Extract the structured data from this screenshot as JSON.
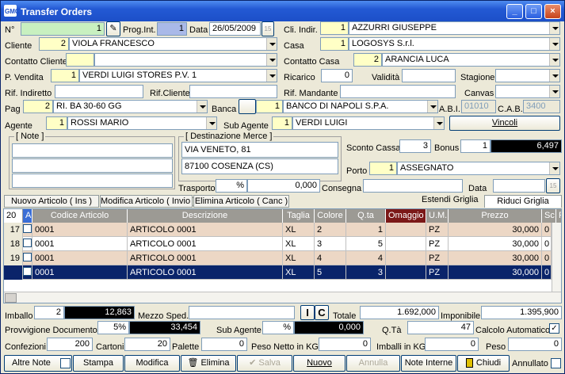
{
  "window": {
    "title": "Transfer Orders",
    "app_icon": "GMC"
  },
  "header": {
    "n_label": "N°",
    "n_value": "1",
    "prog_label": "Prog.Int.",
    "prog_value": "1",
    "data_label": "Data",
    "data_value": "26/05/2009",
    "cal_label": "15",
    "cli_indir_label": "Cli. Indir.",
    "cli_indir_code": "1",
    "cli_indir_name": "AZZURRI GIUSEPPE",
    "cliente_label": "Cliente",
    "cliente_code": "2",
    "cliente_name": "VIOLA FRANCESCO",
    "casa_label": "Casa",
    "casa_code": "1",
    "casa_name": "LOGOSYS S.r.l.",
    "contatto_cliente_label": "Contatto Cliente",
    "contatto_casa_label": "Contatto Casa",
    "contatto_casa_code": "2",
    "contatto_casa_name": "ARANCIA LUCA",
    "pvendita_label": "P. Vendita",
    "pvendita_code": "1",
    "pvendita_name": "VERDI LUIGI STORES P.V. 1",
    "ricarico_label": "Ricarico",
    "ricarico_value": "0",
    "validita_label": "Validità",
    "stagione_label": "Stagione",
    "rif_indiretto_label": "Rif. Indiretto",
    "rif_cliente_label": "Rif.Cliente",
    "rif_mandante_label": "Rif. Mandante",
    "canvas_label": "Canvas",
    "pag_label": "Pag",
    "pag_code": "2",
    "pag_name": "RI. BA 30-60 GG",
    "banca_label": "Banca",
    "banca_code": "1",
    "banca_name": "BANCO DI NAPOLI S.P.A.",
    "abi_label": "A.B.I.",
    "abi_value": "01010",
    "cab_label": "C.A.B.",
    "cab_value": "3400",
    "agente_label": "Agente",
    "agente_code": "1",
    "agente_name": "ROSSI MARIO",
    "sub_agente_label": "Sub Agente",
    "sub_agente_code": "1",
    "sub_agente_name": "VERDI LUIGI",
    "vincoli_label": "Vincoli"
  },
  "note": {
    "title": "[ Note ]"
  },
  "dest": {
    "title": "[ Destinazione Merce ]",
    "line1": "VIA VENETO, 81",
    "line2": "87100 COSENZA (CS)"
  },
  "mid": {
    "sconto_cassa_label": "Sconto Cassa",
    "sconto_cassa_value": "3",
    "bonus_label": "Bonus",
    "bonus_code": "1",
    "bonus_value": "6,497",
    "porto_label": "Porto",
    "porto_code": "1",
    "porto_name": "ASSEGNATO",
    "trasporto_label": "Trasporto",
    "trasporto_pct": "%",
    "trasporto_value": "0,000",
    "consegna_label": "Consegna",
    "data2_label": "Data",
    "cal2_label": "15"
  },
  "tabs": {
    "nuovo_articolo": "Nuovo Articolo ( Ins )",
    "modifica_articolo": "Modifica Articolo ( Invio )",
    "elimina_articolo": "Elimina Articolo ( Canc )",
    "estendi_griglia": "Estendi Griglia",
    "riduci_griglia": "Riduci Griglia"
  },
  "grid": {
    "count": "20",
    "headers": [
      "A",
      "Codice Articolo",
      "Descrizione",
      "Taglia",
      "Colore",
      "Q.ta",
      "Omaggio",
      "U.M.",
      "Prezzo",
      "Sc %",
      "F"
    ],
    "rows": [
      {
        "n": "17",
        "code": "0001",
        "desc": "ARTICOLO 0001",
        "taglia": "XL",
        "colore": "2",
        "qta": "1",
        "um": "PZ",
        "prezzo": "30,000",
        "sc": "0"
      },
      {
        "n": "18",
        "code": "0001",
        "desc": "ARTICOLO 0001",
        "taglia": "XL",
        "colore": "3",
        "qta": "5",
        "um": "PZ",
        "prezzo": "30,000",
        "sc": "0"
      },
      {
        "n": "19",
        "code": "0001",
        "desc": "ARTICOLO 0001",
        "taglia": "XL",
        "colore": "4",
        "qta": "4",
        "um": "PZ",
        "prezzo": "30,000",
        "sc": "0"
      },
      {
        "n": "",
        "code": "0001",
        "desc": "ARTICOLO 0001",
        "taglia": "XL",
        "colore": "5",
        "qta": "3",
        "um": "PZ",
        "prezzo": "30,000",
        "sc": "0"
      }
    ]
  },
  "footer": {
    "imballo_label": "Imballo",
    "imballo_code": "2",
    "imballo_value": "12,863",
    "mezzo_sped_label": "Mezzo Sped.",
    "i_label": "I",
    "c_label": "C",
    "totale_label": "Totale",
    "totale_value": "1.692,000",
    "imponibile_label": "Imponibile",
    "imponibile_value": "1.395,900",
    "provvigione_label": "Provvigione Documento",
    "provvigione_pct": "5%",
    "provvigione_value": "33,454",
    "sub_agente_label": "Sub Agente",
    "sub_agente_pct": "%",
    "sub_agente_value": "0,000",
    "qta_label": "Q.Tà",
    "qta_value": "47",
    "calcolo_label": "Calcolo Automatico",
    "confezioni_label": "Confezioni",
    "confezioni_value": "200",
    "cartoni_label": "Cartoni",
    "cartoni_value": "20",
    "palette_label": "Palette",
    "palette_value": "0",
    "peso_netto_label": "Peso Netto in KG",
    "peso_netto_value": "0",
    "imballi_label": "Imballi in KG",
    "imballi_value": "0",
    "peso_label": "Peso",
    "peso_value": "0"
  },
  "buttons": {
    "altre_note": "Altre Note",
    "stampa": "Stampa",
    "modifica": "Modifica",
    "elimina": "Elimina",
    "salva": "Salva",
    "nuovo": "Nuovo",
    "annulla": "Annulla",
    "note_interne": "Note Interne",
    "chiudi": "Chiudi",
    "annullato": "Annullato"
  }
}
